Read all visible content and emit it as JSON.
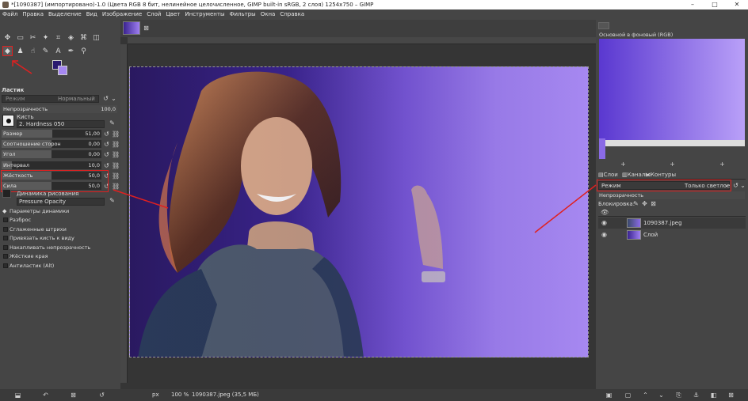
{
  "titlebar": {
    "title": "*[1090387] (импортировано)-1.0 (Цвета RGB 8 бит, нелинейное целочисленное, GIMP built-in sRGB, 2 слоя) 1254x750 – GIMP"
  },
  "menu": [
    "Файл",
    "Правка",
    "Выделение",
    "Вид",
    "Изображение",
    "Слой",
    "Цвет",
    "Инструменты",
    "Фильтры",
    "Окна",
    "Справка"
  ],
  "tool_options": {
    "title": "Ластик",
    "mode_label": "Режим",
    "mode_value": "Нормальный",
    "opacity_label": "Непрозрачность",
    "opacity_value": "100,0",
    "brush_label": "Кисть",
    "brush_value": "2. Hardness 050",
    "sliders": [
      {
        "label": "Размер",
        "value": "51,00",
        "fraction": 0.51
      },
      {
        "label": "Соотношение сторон",
        "value": "0,00",
        "fraction": 0.5
      },
      {
        "label": "Угол",
        "value": "0,00",
        "fraction": 0.5
      },
      {
        "label": "Интервал",
        "value": "10,0",
        "fraction": 0.1
      },
      {
        "label": "Жёсткость",
        "value": "50,0",
        "fraction": 0.5
      },
      {
        "label": "Сила",
        "value": "50,0",
        "fraction": 0.5
      }
    ],
    "dynamics_label": "Динамика рисования",
    "dynamics_value": "Pressure Opacity",
    "dynamics_params_label": "Параметры динамики",
    "options": [
      "Разброс",
      "Сглаженные штрихи",
      "Привязать кисть к виду",
      "Накапливать непрозрачность",
      "Жёсткие края",
      "Антиластик (Alt)"
    ]
  },
  "status": {
    "unit": "px",
    "zoom": "100 %",
    "info": "1090387.jpeg (35,5 МБ)"
  },
  "right": {
    "navigator_label": "Основной в фоновый (RGB)",
    "tabs": [
      "Слои",
      "Каналы",
      "Контуры"
    ],
    "mode_label": "Режим",
    "mode_value": "Только светлое",
    "opacity_label": "Непрозрачность",
    "lock_label": "Блокировка:",
    "layers": [
      {
        "name": "1090387.jpeg"
      },
      {
        "name": "Слой"
      }
    ]
  },
  "colors": {
    "highlight": "#e02020",
    "gradient_start": "#2a1960",
    "gradient_end": "#aa8cf2"
  }
}
